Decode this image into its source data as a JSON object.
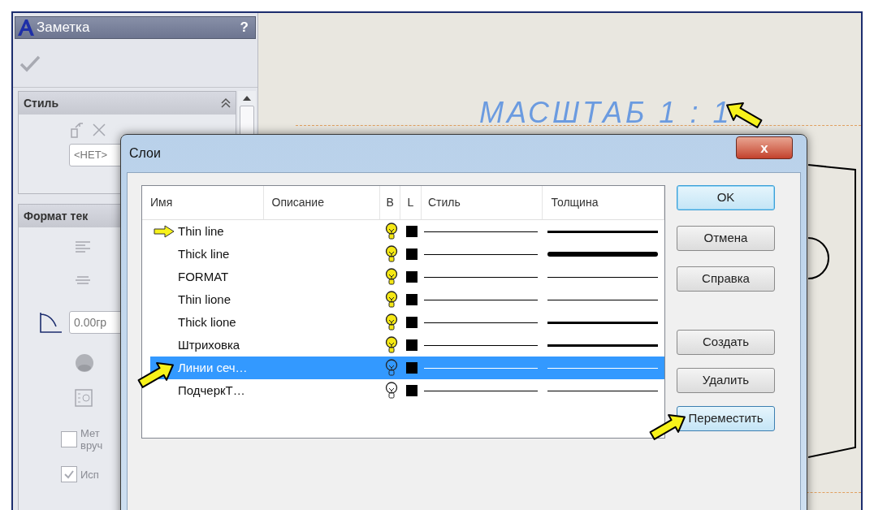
{
  "panel": {
    "title": "Заметка",
    "help": "?",
    "style_section": {
      "title": "Стиль",
      "dropdown": "<НЕТ>"
    },
    "format_section": {
      "title": "Формат тек",
      "angle": "0.00гр",
      "checkboxes": [
        {
          "lines": [
            "Мет",
            "вруч"
          ],
          "checked": false
        },
        {
          "lines": [
            "Исп"
          ],
          "checked": true
        }
      ]
    }
  },
  "canvas": {
    "scale_label": "МАСШТАБ 1 : 1"
  },
  "dialog": {
    "title": "Слои",
    "close": "x",
    "columns": [
      "Имя",
      "Описание",
      "B",
      "L",
      "Стиль",
      "Толщина"
    ],
    "rows": [
      {
        "name": "Thin line",
        "current": true,
        "visible": true,
        "selected": false,
        "color": "#000000",
        "kind": "medium"
      },
      {
        "name": "Thick line",
        "current": false,
        "visible": true,
        "selected": false,
        "color": "#000000",
        "kind": "thick"
      },
      {
        "name": "FORMAT",
        "current": false,
        "visible": true,
        "selected": false,
        "color": "#000000",
        "kind": "thin"
      },
      {
        "name": "Thin lione",
        "current": false,
        "visible": true,
        "selected": false,
        "color": "#000000",
        "kind": "thin"
      },
      {
        "name": "Thick lione",
        "current": false,
        "visible": true,
        "selected": false,
        "color": "#000000",
        "kind": "medium"
      },
      {
        "name": "Штриховка",
        "current": false,
        "visible": true,
        "selected": false,
        "color": "#000000",
        "kind": "medium"
      },
      {
        "name": "Линии сеч…",
        "current": false,
        "visible": false,
        "selected": true,
        "color": "#000000",
        "kind": "thin"
      },
      {
        "name": "ПодчеркТ…",
        "current": false,
        "visible": false,
        "selected": false,
        "color": "#000000",
        "kind": "thin"
      }
    ],
    "buttons_top": [
      {
        "label": "OK",
        "default": true,
        "hot": false
      },
      {
        "label": "Отмена",
        "default": false,
        "hot": false
      },
      {
        "label": "Справка",
        "default": false,
        "hot": false
      }
    ],
    "buttons_bottom": [
      {
        "label": "Создать",
        "default": false,
        "hot": false
      },
      {
        "label": "Удалить",
        "default": false,
        "hot": false
      },
      {
        "label": "Переместить",
        "default": false,
        "hot": true
      }
    ]
  }
}
